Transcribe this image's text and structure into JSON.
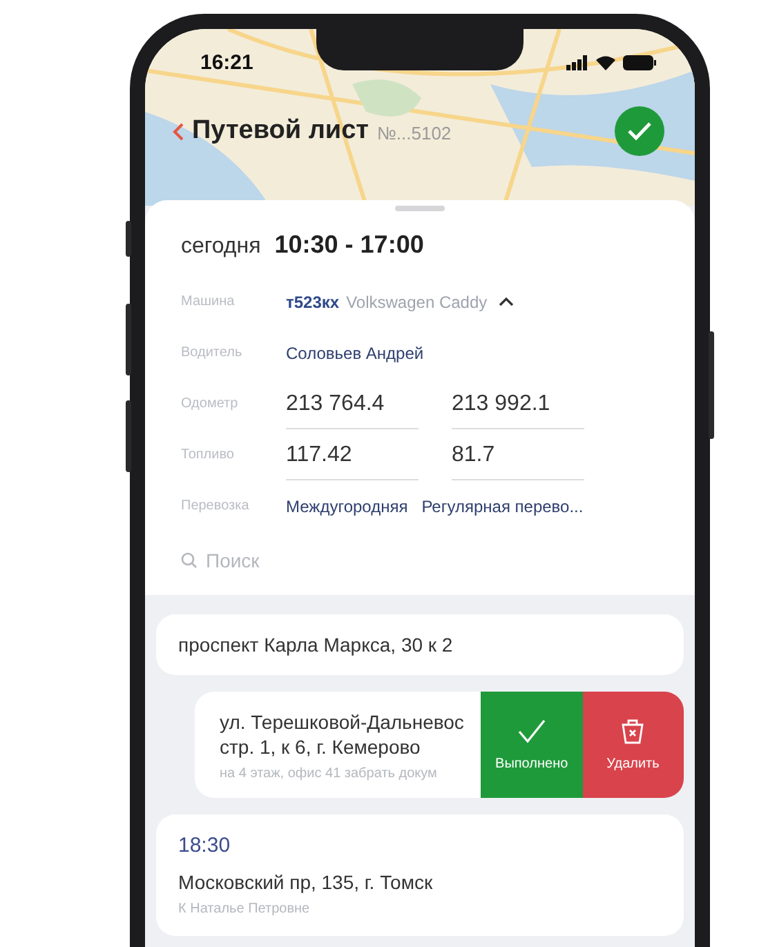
{
  "status_bar": {
    "time": "16:21"
  },
  "header": {
    "title": "Путевой лист",
    "number": "№...5102",
    "completed": true
  },
  "schedule": {
    "day": "сегодня",
    "time_range": "10:30 - 17:00"
  },
  "details": [
    {
      "kind": "vehicle",
      "label": "Машина",
      "plate": "т523кх",
      "model": "Volkswagen Caddy",
      "expanded": true
    },
    {
      "kind": "link",
      "label": "Водитель",
      "value": "Соловьев Андрей"
    },
    {
      "kind": "pair",
      "label": "Одометр",
      "values": [
        "213 764.4",
        "213 992.1"
      ]
    },
    {
      "kind": "pair",
      "label": "Топливо",
      "values": [
        "117.42",
        "81.7"
      ]
    },
    {
      "kind": "links",
      "label": "Перевозка",
      "values": [
        "Междугородняя",
        "Регулярная перево..."
      ]
    }
  ],
  "search": {
    "placeholder": "Поиск"
  },
  "stops": [
    {
      "kind": "plain",
      "address": "проспект Карла Маркса, 30 к 2"
    },
    {
      "kind": "swiped",
      "address_lines": [
        "ул. Терешковой-Дальневос",
        "стр. 1, к 6, г. Кемерово"
      ],
      "note": "на 4 этаж, офис 41 забрать докум",
      "actions": [
        {
          "kind": "done",
          "label": "Выполнено"
        },
        {
          "kind": "delete",
          "label": "Удалить"
        }
      ]
    },
    {
      "kind": "timed",
      "time": "18:30",
      "address": "Московский пр, 135, г. Томск",
      "note": "К Наталье Петровне"
    }
  ]
}
